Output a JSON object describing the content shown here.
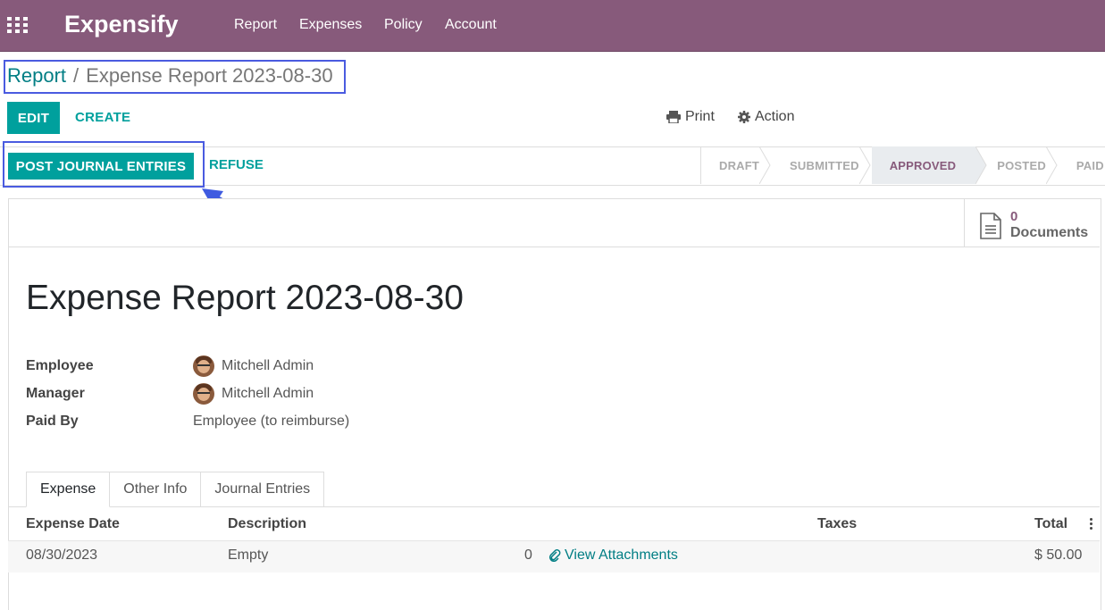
{
  "navbar": {
    "brand": "Expensify",
    "menu": [
      "Report",
      "Expenses",
      "Policy",
      "Account"
    ]
  },
  "breadcrumb": {
    "parent": "Report",
    "separator": "/",
    "current": "Expense Report 2023-08-30"
  },
  "controls": {
    "edit": "EDIT",
    "create": "CREATE",
    "print": "Print",
    "action": "Action"
  },
  "statusbar": {
    "post_button": "POST JOURNAL ENTRIES",
    "refuse_button": "REFUSE",
    "stages": [
      "DRAFT",
      "SUBMITTED",
      "APPROVED",
      "POSTED",
      "PAID"
    ],
    "active_stage": "APPROVED"
  },
  "smart_button": {
    "count": "0",
    "label": "Documents"
  },
  "form": {
    "title": "Expense Report 2023-08-30",
    "fields": [
      {
        "label": "Employee",
        "value": "Mitchell Admin"
      },
      {
        "label": "Manager",
        "value": "Mitchell Admin"
      },
      {
        "label": "Paid By",
        "value": "Employee (to reimburse)"
      }
    ]
  },
  "tabs": [
    "Expense",
    "Other Info",
    "Journal Entries"
  ],
  "table": {
    "headers": {
      "date": "Expense Date",
      "description": "Description",
      "taxes": "Taxes",
      "total": "Total"
    },
    "rows": [
      {
        "date": "08/30/2023",
        "description": "Empty",
        "qty": "0",
        "attachments": "View Attachments",
        "total": "$ 50.00"
      }
    ]
  },
  "colors": {
    "brand": "#875a7b",
    "primary": "#00a09d",
    "link": "#017e84",
    "highlight": "#4a5be0"
  }
}
